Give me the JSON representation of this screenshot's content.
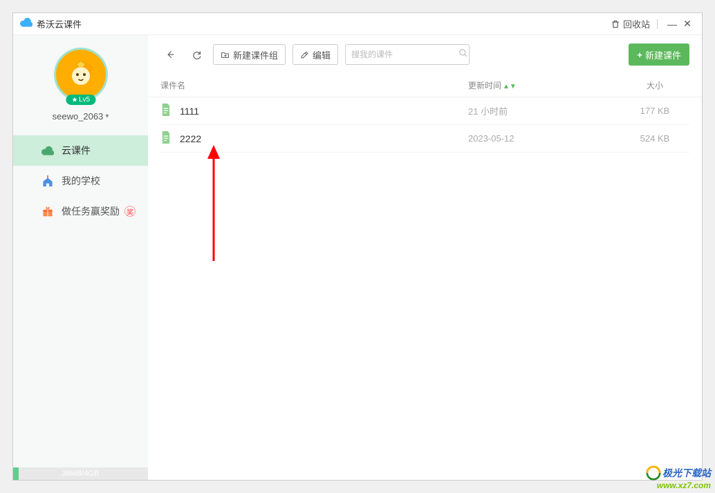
{
  "title": "希沃云课件",
  "titlebar": {
    "recycle": "回收站"
  },
  "user": {
    "name": "seewo_2063",
    "level": "Lv5"
  },
  "sidebar": {
    "items": [
      {
        "label": "云课件"
      },
      {
        "label": "我的学校"
      },
      {
        "label": "做任务赢奖励",
        "tag": "奖"
      }
    ]
  },
  "storage": {
    "text": "38MB/4GB",
    "percent": 4
  },
  "toolbar": {
    "new_group": "新建课件组",
    "edit": "编辑",
    "search_placeholder": "搜我的课件",
    "new_doc": "新建课件"
  },
  "columns": {
    "name": "课件名",
    "time": "更新时间",
    "size": "大小"
  },
  "files": [
    {
      "name": "1111",
      "time": "21 小时前",
      "size": "177 KB"
    },
    {
      "name": "2222",
      "time": "2023-05-12",
      "size": "524 KB"
    }
  ],
  "watermark": {
    "line1": "极光下载站",
    "line2": "www.xz7.com"
  }
}
